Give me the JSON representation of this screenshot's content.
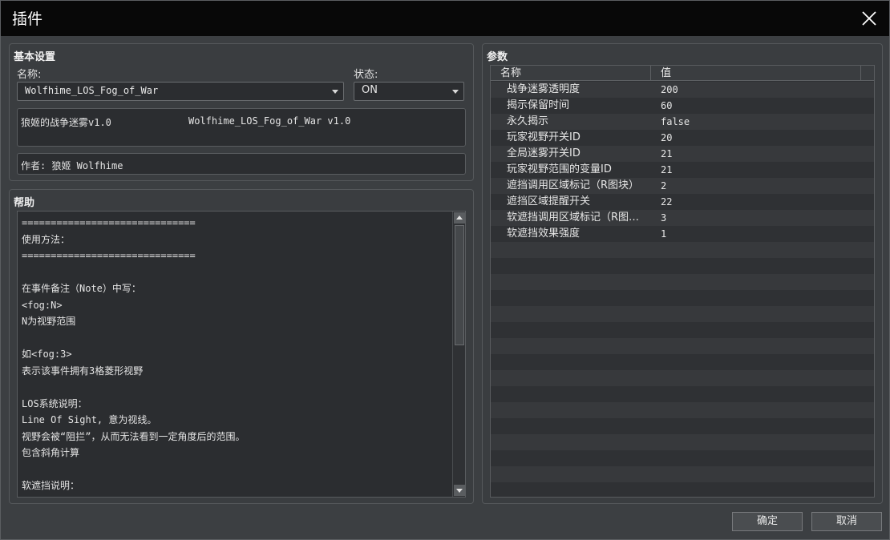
{
  "window": {
    "title": "插件"
  },
  "basic": {
    "title": "基本设置",
    "name_label": "名称:",
    "name_value": "Wolfhime_LOS_Fog_of_War",
    "status_label": "状态:",
    "status_value": "ON",
    "description_left": "狼姬的战争迷雾v1.0",
    "description_right": "Wolfhime_LOS_Fog_of_War v1.0",
    "author": "作者: 狼姬 Wolfhime"
  },
  "help": {
    "title": "帮助",
    "lines": [
      "==============================",
      "使用方法：",
      "==============================",
      "",
      "在事件备注（Note）中写：",
      "<fog:N>",
      "N为视野范围",
      "",
      "如<fog:3>",
      "表示该事件拥有3格菱形视野",
      "",
      "LOS系统说明：",
      "Line Of Sight, 意为视线。",
      "视野会被“阻拦”，从而无法看到一定角度后的范围。",
      "包含斜角计算",
      "",
      "软遮挡说明："
    ]
  },
  "params": {
    "title": "参数",
    "col_name": "名称",
    "col_value": "值",
    "rows": [
      {
        "name": "战争迷雾透明度",
        "value": "200"
      },
      {
        "name": "揭示保留时间",
        "value": "60"
      },
      {
        "name": "永久揭示",
        "value": "false"
      },
      {
        "name": "玩家视野开关ID",
        "value": "20"
      },
      {
        "name": "全局迷雾开关ID",
        "value": "21"
      },
      {
        "name": "玩家视野范围的变量ID",
        "value": "21"
      },
      {
        "name": "遮挡调用区域标记（R图块）",
        "value": "2"
      },
      {
        "name": "遮挡区域提醒开关",
        "value": "22"
      },
      {
        "name": "软遮挡调用区域标记（R图…",
        "value": "3"
      },
      {
        "name": "软遮挡效果强度",
        "value": "1"
      }
    ]
  },
  "buttons": {
    "ok": "确定",
    "cancel": "取消"
  },
  "colors": {
    "titlebar": "#080808",
    "panel": "#3a3d40",
    "field": "#2b2d30",
    "table_alt": "#37393c"
  },
  "icons": {
    "close": "close-icon",
    "dropdown": "chevron-down-icon"
  }
}
